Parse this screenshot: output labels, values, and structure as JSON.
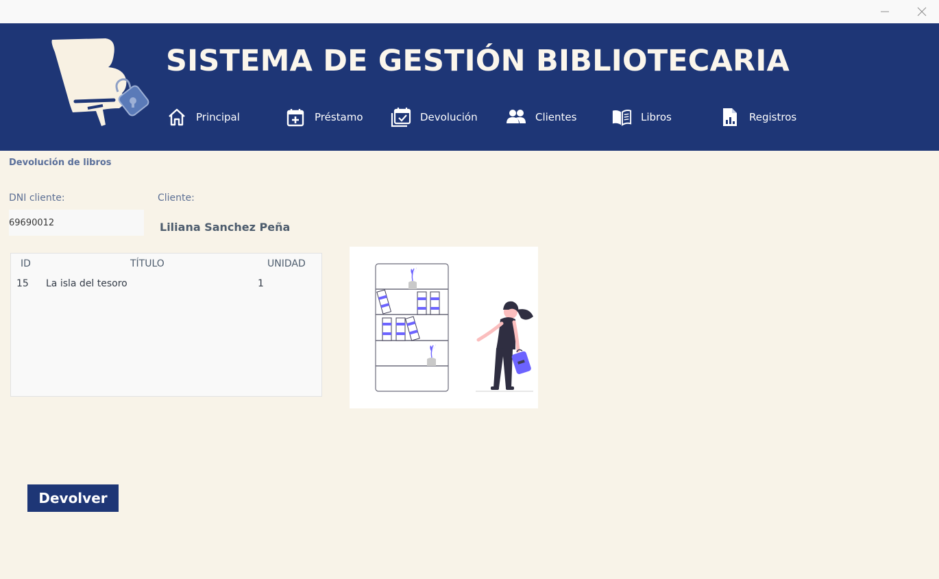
{
  "window": {
    "minimize_icon": "minimize-icon",
    "close_icon": "close-icon"
  },
  "header": {
    "title": "SISTEMA DE GESTIÓN BIBLIOTECARIA",
    "logo_icon": "library-book-lock-logo",
    "nav": [
      {
        "label": "Principal",
        "icon": "home-icon"
      },
      {
        "label": "Préstamo",
        "icon": "calendar-plus-icon"
      },
      {
        "label": "Devolución",
        "icon": "calendar-check-icon"
      },
      {
        "label": "Clientes",
        "icon": "users-icon"
      },
      {
        "label": "Libros",
        "icon": "open-book-icon"
      },
      {
        "label": "Registros",
        "icon": "report-chart-icon"
      }
    ]
  },
  "page": {
    "section_title": "Devolución de libros",
    "dni_label": "DNI cliente:",
    "dni_value": "69690012",
    "client_label": "Cliente:",
    "client_name": "Liliana Sanchez Peña"
  },
  "table": {
    "headers": [
      "ID",
      "TÍTULO",
      "UNIDAD"
    ],
    "rows": [
      [
        "15",
        "La isla del tesoro",
        "1"
      ]
    ]
  },
  "illustration": "woman-with-bookshelf-illustration",
  "actions": {
    "return_label": "Devolver"
  },
  "colors": {
    "header_bg": "#1e3676",
    "page_bg": "#f8f3e8",
    "accent": "#6c63ff"
  }
}
